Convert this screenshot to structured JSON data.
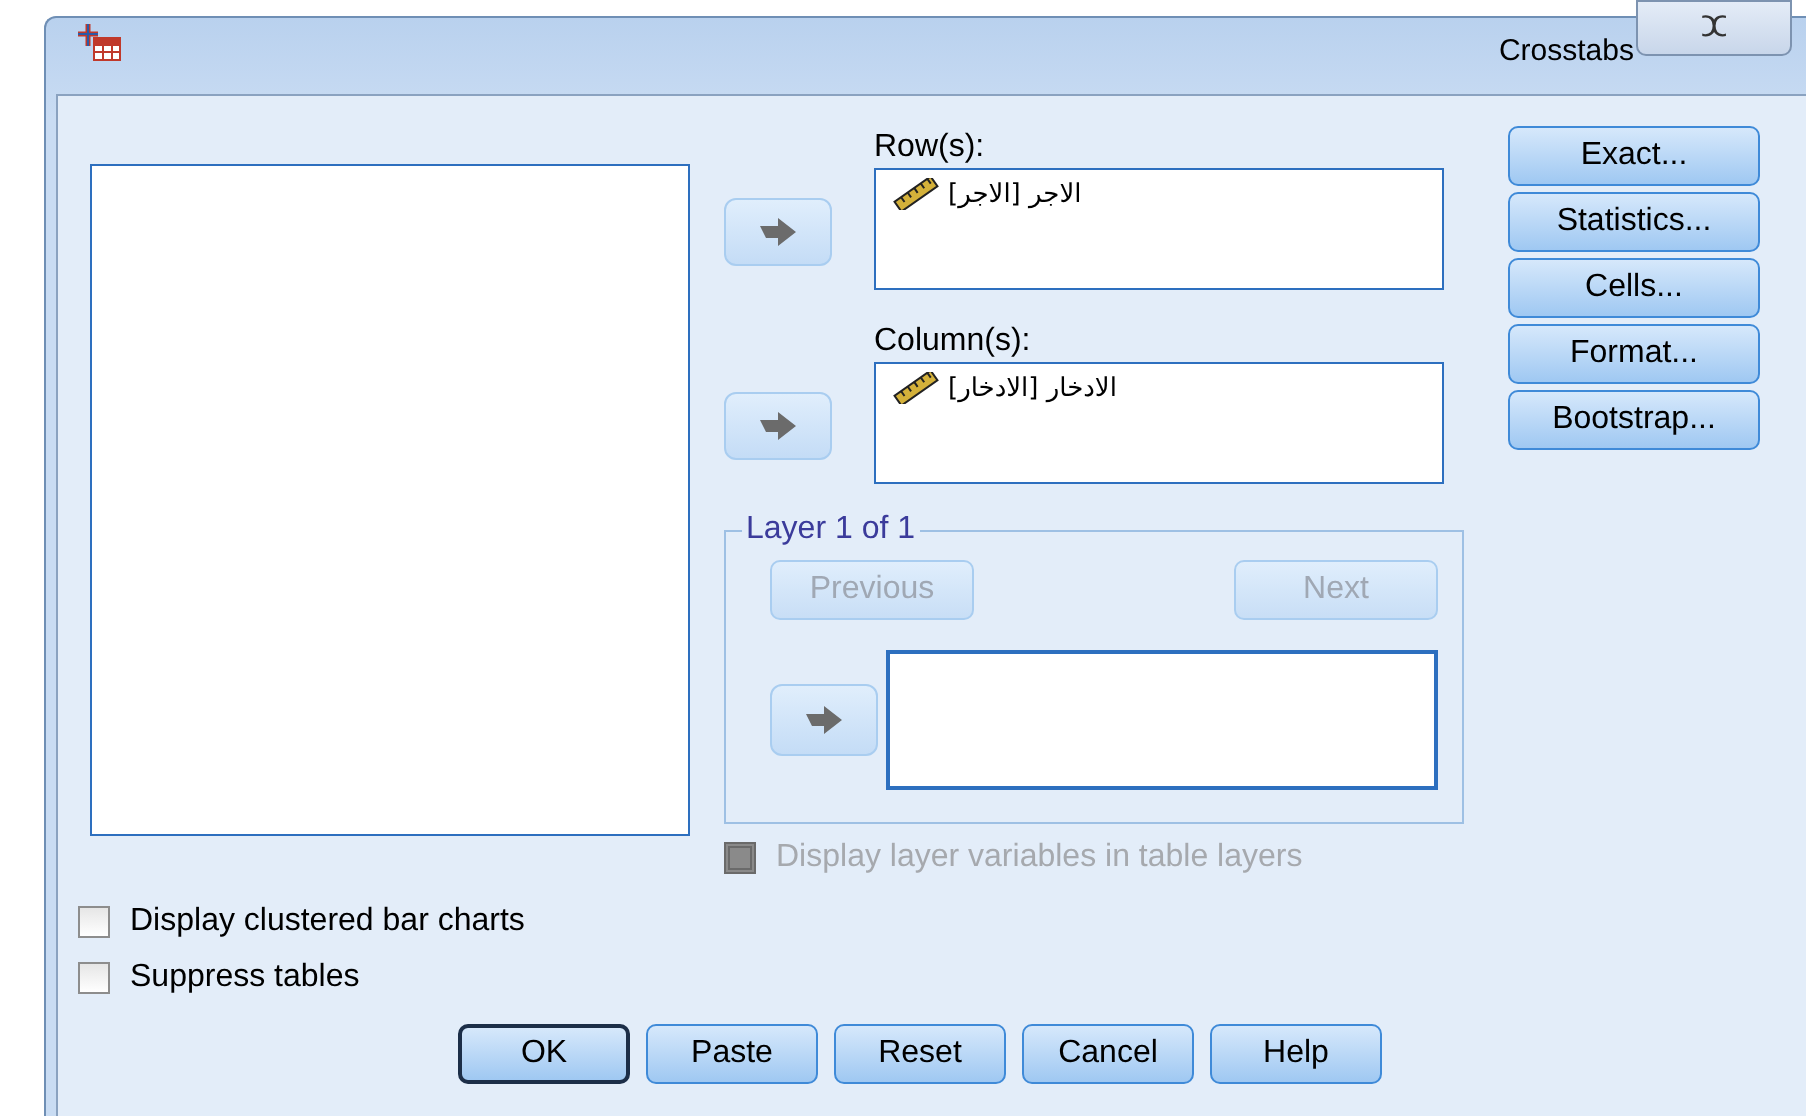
{
  "window": {
    "title": "Crosstabs",
    "close_label": "ⵋ"
  },
  "row_list": {
    "label": "Row(s):",
    "items": [
      {
        "text": "الاجر [الاجر]"
      }
    ]
  },
  "column_list": {
    "label": "Column(s):",
    "items": [
      {
        "text": "الادخار [الادخار]"
      }
    ]
  },
  "layer": {
    "title": "Layer 1 of 1",
    "buttons": [
      {
        "label": "Previous",
        "disabled": true
      },
      {
        "label": "Next",
        "disabled": true
      }
    ]
  },
  "side_buttons": [
    "Exact...",
    "Statistics...",
    "Cells...",
    "Format...",
    "Bootstrap..."
  ],
  "display_layer": {
    "label": "Display layer variables in table layers",
    "checked": false,
    "disabled": true
  },
  "options": [
    {
      "label": "Display clustered bar charts",
      "checked": false
    },
    {
      "label": "Suppress tables",
      "checked": false
    }
  ],
  "buttons": [
    {
      "label": "OK",
      "default": true
    },
    {
      "label": "Paste",
      "default": false
    },
    {
      "label": "Reset",
      "default": false
    },
    {
      "label": "Cancel",
      "default": false
    },
    {
      "label": "Help",
      "default": false
    }
  ]
}
